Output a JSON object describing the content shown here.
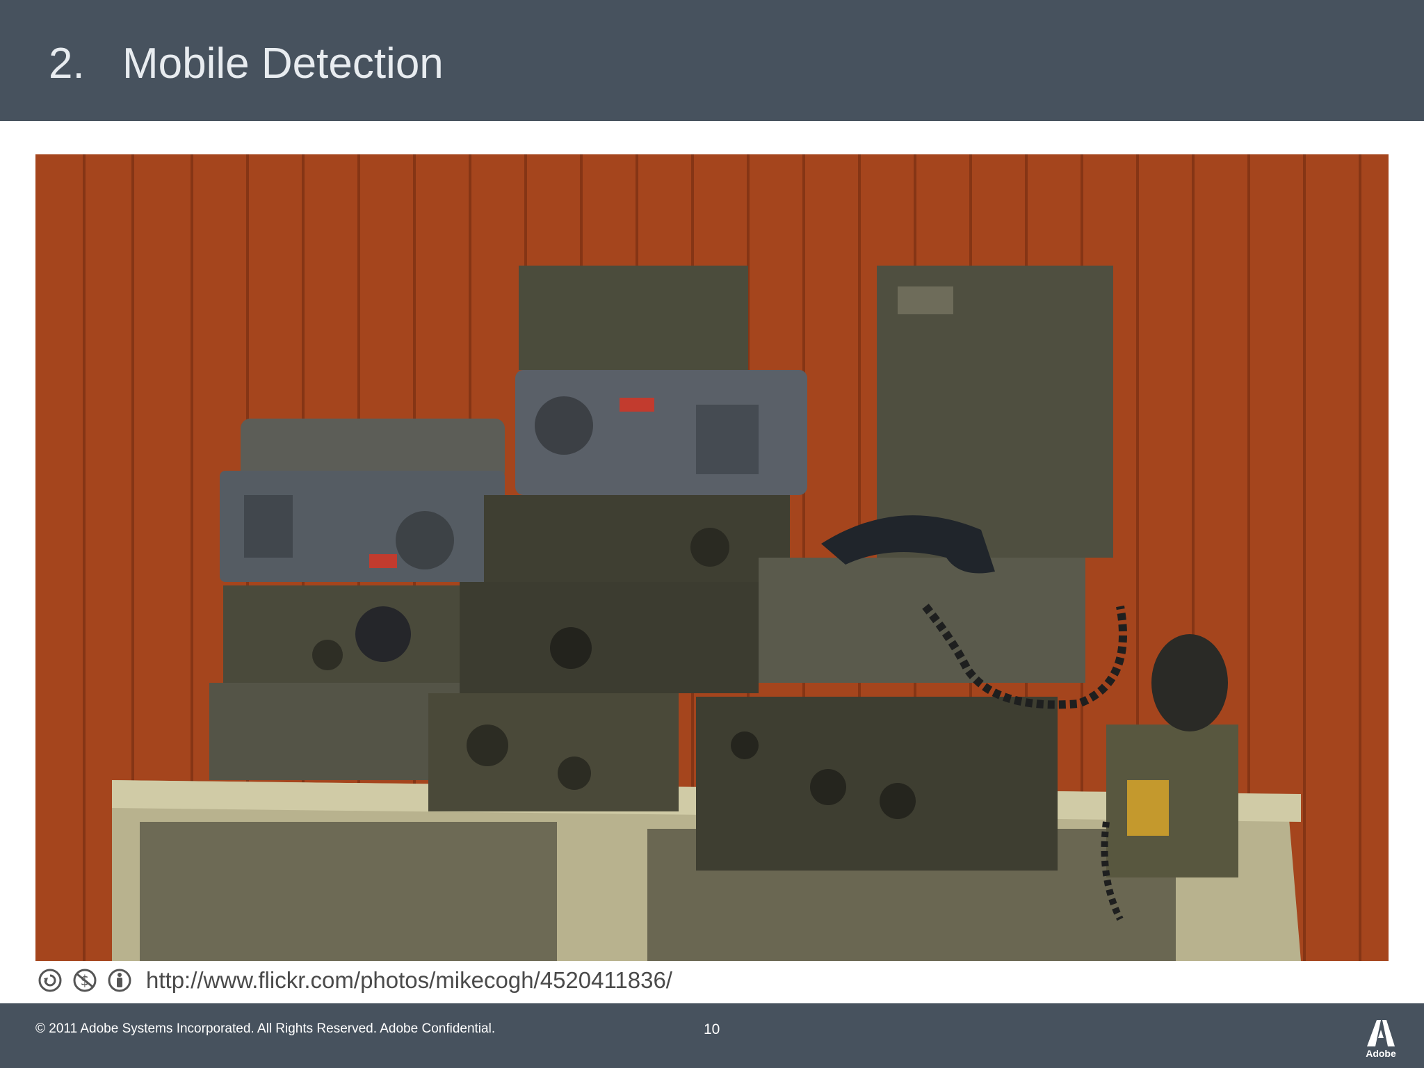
{
  "slide": {
    "title_number": "2.",
    "title_text": "Mobile Detection"
  },
  "image": {
    "description_icon": "vintage-military-radios-photo"
  },
  "caption": {
    "license_icons": [
      "cc-share-alike-icon",
      "cc-noncommercial-icon",
      "cc-attribution-icon"
    ],
    "url": "http://www.flickr.com/photos/mikecogh/4520411836/"
  },
  "footer": {
    "copyright": "© 2011 Adobe Systems Incorporated.  All Rights Reserved.  Adobe Confidential.",
    "page_number": "10",
    "logo_text": "Adobe"
  },
  "colors": {
    "header_bg": "#47525e",
    "footer_bg": "#47525e",
    "wall": "#a8481f",
    "equipment": "#4b4a3a"
  }
}
